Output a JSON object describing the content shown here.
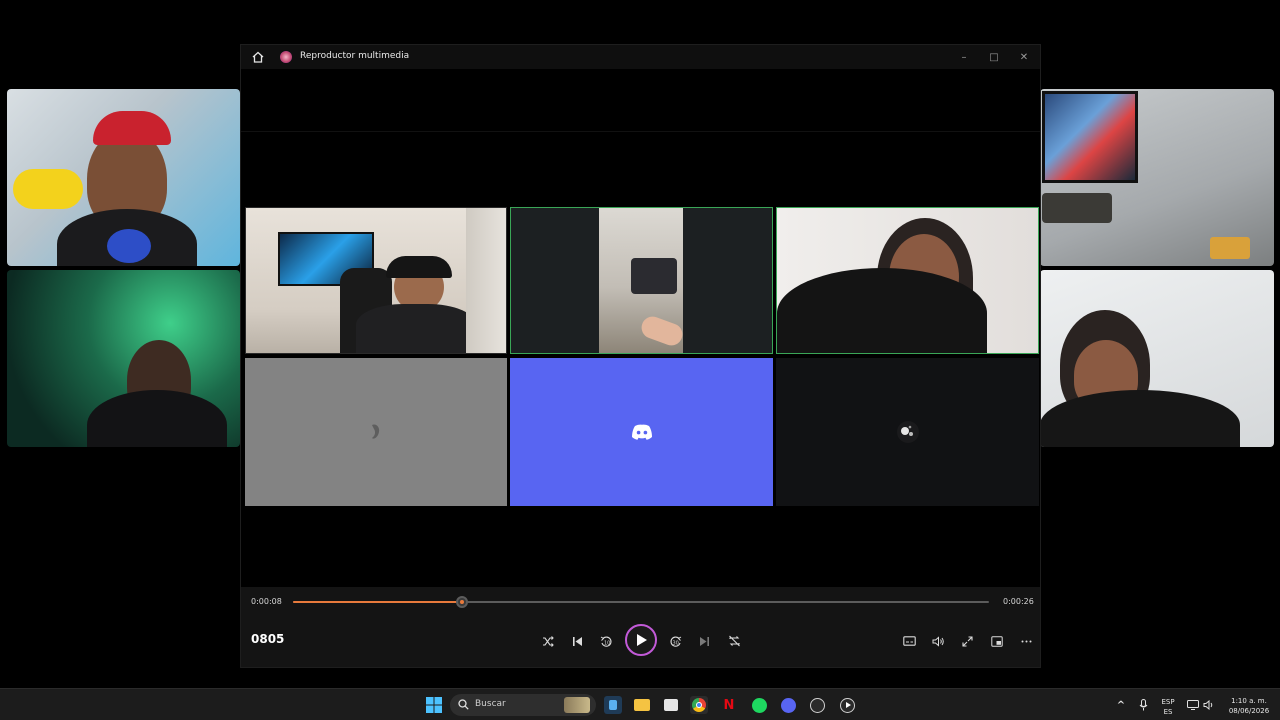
{
  "window": {
    "title": "Reproductor multimedia",
    "controls": {
      "minimize": "–",
      "maximize": "□",
      "close": "✕"
    }
  },
  "player": {
    "current_time": "0:00:08",
    "total_time": "0:00:26",
    "progress": 0.243,
    "media_title": "0805",
    "accent_color": "#e87a3c",
    "buttons": [
      "shuffle-icon",
      "previous-icon",
      "rewind-10-icon",
      "play-icon",
      "forward-30-icon",
      "next-icon",
      "repeat-off-icon"
    ],
    "right_buttons": [
      "subtitles-icon",
      "volume-icon",
      "fullscreen-icon",
      "mini-player-icon",
      "more-icon"
    ]
  },
  "call": {
    "discord_color": "#5865f2",
    "active_speaker_color": "#3aa657"
  },
  "taskbar": {
    "search_placeholder": "Buscar",
    "language_top": "ESP",
    "language_bottom": "ES",
    "clock_time": "1:10 a. m.",
    "clock_date": "08/06/2026"
  }
}
